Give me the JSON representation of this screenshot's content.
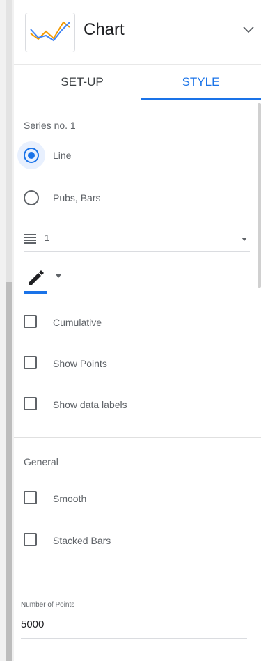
{
  "header": {
    "title": "Chart",
    "chart_icon": "line-chart-icon",
    "toggle_icon": "chevron-down-icon"
  },
  "tabs": [
    {
      "label": "SET-UP",
      "active": false
    },
    {
      "label": "STYLE",
      "active": true
    }
  ],
  "series": {
    "title": "Series no. 1",
    "type_options": [
      {
        "label": "Line",
        "selected": true
      },
      {
        "label": "Pubs, Bars",
        "selected": false
      }
    ],
    "line_weight": {
      "icon": "line-weight-icon",
      "value": "1"
    },
    "color_picker": {
      "icon": "pencil-icon",
      "color": "#1a73e8"
    },
    "checkboxes": [
      {
        "label": "Cumulative",
        "checked": false
      },
      {
        "label": "Show Points",
        "checked": false
      },
      {
        "label": "Show data labels",
        "checked": false
      }
    ]
  },
  "general": {
    "title": "General",
    "checkboxes": [
      {
        "label": "Smooth",
        "checked": false
      },
      {
        "label": "Stacked Bars",
        "checked": false
      }
    ]
  },
  "number_of_points": {
    "label": "Number of Points",
    "value": "5000"
  },
  "colors": {
    "accent": "#1a73e8",
    "text": "#5f6368",
    "divider": "#e0e0e0"
  }
}
